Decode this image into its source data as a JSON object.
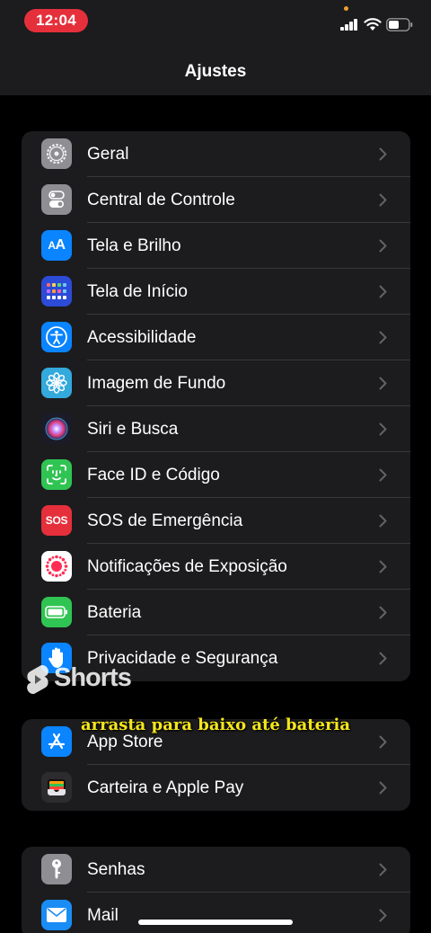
{
  "status_bar": {
    "time": "12:04"
  },
  "header": {
    "title": "Ajustes"
  },
  "group1": [
    {
      "label": "Geral",
      "icon": "gear-icon",
      "color": "#8e8e93"
    },
    {
      "label": "Central de Controle",
      "icon": "toggles-icon",
      "color": "#8e8e93"
    },
    {
      "label": "Tela e Brilho",
      "icon": "text-size-icon",
      "color": "#0a84ff"
    },
    {
      "label": "Tela de Início",
      "icon": "home-grid-icon",
      "color": "#2c4bd6"
    },
    {
      "label": "Acessibilidade",
      "icon": "accessibility-icon",
      "color": "#0a84ff"
    },
    {
      "label": "Imagem de Fundo",
      "icon": "wallpaper-flower-icon",
      "color": "#33a9dc"
    },
    {
      "label": "Siri e Busca",
      "icon": "siri-icon",
      "color": "#1b1b2a"
    },
    {
      "label": "Face ID e Código",
      "icon": "face-id-icon",
      "color": "#30c453"
    },
    {
      "label": "SOS de Emergência",
      "icon": "sos-icon",
      "color": "#e5303c"
    },
    {
      "label": "Notificações de Exposição",
      "icon": "exposure-icon",
      "color": "#ffffff"
    },
    {
      "label": "Bateria",
      "icon": "battery-icon",
      "color": "#30c453"
    },
    {
      "label": "Privacidade e Segurança",
      "icon": "hand-icon",
      "color": "#0a84ff"
    }
  ],
  "group2": [
    {
      "label": "App Store",
      "icon": "app-store-icon",
      "color": "#0a84ff"
    },
    {
      "label": "Carteira e Apple Pay",
      "icon": "wallet-icon",
      "color": "#1c1c1e"
    }
  ],
  "group3": [
    {
      "label": "Senhas",
      "icon": "key-icon",
      "color": "#8e8e93"
    },
    {
      "label": "Mail",
      "icon": "mail-icon",
      "color": "#1a8cf5"
    }
  ],
  "overlay": {
    "shorts_label": "Shorts",
    "caption": "arrasta para baixo até bateria"
  }
}
